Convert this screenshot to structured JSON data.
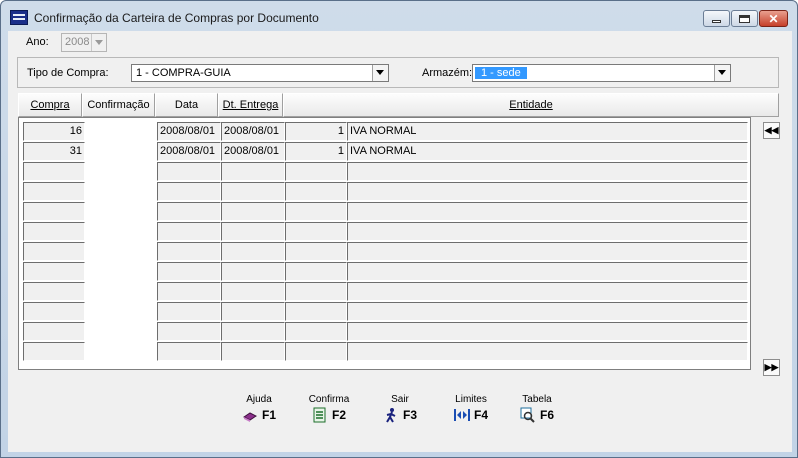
{
  "window": {
    "title": "Confirmação da Carteira de Compras por Documento",
    "controls": {
      "minimize": "minimize-icon",
      "maximize": "maximize-icon",
      "close": "✕"
    }
  },
  "filters": {
    "ano_label": "Ano:",
    "ano_value": "2008",
    "tipo_label": "Tipo de Compra:",
    "tipo_value": "1 - COMPRA-GUIA",
    "armazem_label": "Armazém:",
    "armazem_value": "1 - sede"
  },
  "table": {
    "columns": [
      "Compra",
      "Confirmação",
      "Data",
      "Dt. Entrega",
      "",
      "Entidade"
    ],
    "rows": [
      {
        "compra": "16",
        "confirmacao": "",
        "data": "2008/08/01",
        "entrega": "2008/08/01",
        "qtd": "1",
        "entidade": "IVA NORMAL"
      },
      {
        "compra": "31",
        "confirmacao": "",
        "data": "2008/08/01",
        "entrega": "2008/08/01",
        "qtd": "1",
        "entidade": "IVA NORMAL"
      },
      {
        "compra": "",
        "confirmacao": "",
        "data": "",
        "entrega": "",
        "qtd": "",
        "entidade": ""
      },
      {
        "compra": "",
        "confirmacao": "",
        "data": "",
        "entrega": "",
        "qtd": "",
        "entidade": ""
      },
      {
        "compra": "",
        "confirmacao": "",
        "data": "",
        "entrega": "",
        "qtd": "",
        "entidade": ""
      },
      {
        "compra": "",
        "confirmacao": "",
        "data": "",
        "entrega": "",
        "qtd": "",
        "entidade": ""
      },
      {
        "compra": "",
        "confirmacao": "",
        "data": "",
        "entrega": "",
        "qtd": "",
        "entidade": ""
      },
      {
        "compra": "",
        "confirmacao": "",
        "data": "",
        "entrega": "",
        "qtd": "",
        "entidade": ""
      },
      {
        "compra": "",
        "confirmacao": "",
        "data": "",
        "entrega": "",
        "qtd": "",
        "entidade": ""
      },
      {
        "compra": "",
        "confirmacao": "",
        "data": "",
        "entrega": "",
        "qtd": "",
        "entidade": ""
      },
      {
        "compra": "",
        "confirmacao": "",
        "data": "",
        "entrega": "",
        "qtd": "",
        "entidade": ""
      },
      {
        "compra": "",
        "confirmacao": "",
        "data": "",
        "entrega": "",
        "qtd": "",
        "entidade": ""
      }
    ],
    "scroll_top": "◀◀",
    "scroll_bottom": "▶▶"
  },
  "function_keys": [
    {
      "caption": "Ajuda",
      "key": "F1",
      "icon": "book-icon",
      "color": "#8b2f8b"
    },
    {
      "caption": "Confirma",
      "key": "F2",
      "icon": "checklist-icon",
      "color": "#1c6e2a"
    },
    {
      "caption": "Sair",
      "key": "F3",
      "icon": "walking-person-icon",
      "color": "#1a237e"
    },
    {
      "caption": "Limites",
      "key": "F4",
      "icon": "limits-arrows-icon",
      "color": "#1a4db3"
    },
    {
      "caption": "Tabela",
      "key": "F6",
      "icon": "table-search-icon",
      "color": "#1f6f9e"
    }
  ],
  "colors": {
    "title_bg": "#c2d3e6",
    "selection": "#3399ff",
    "close_button": "#c6402a"
  }
}
